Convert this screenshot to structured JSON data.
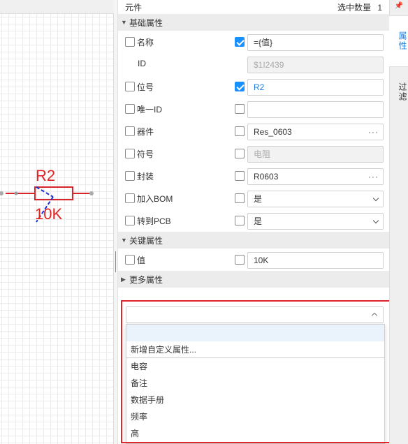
{
  "canvas": {
    "component_ref": "R2",
    "component_value": "10K",
    "colors": {
      "wire": "#d7262b",
      "label": "#e32222",
      "body": "#e32222",
      "dash": "#1a2fcf",
      "pin": "#999999"
    }
  },
  "panel": {
    "header": {
      "title": "元件",
      "count_label": "选中数量",
      "count": "1"
    },
    "sections": {
      "basic": "基础属性",
      "key": "关键属性",
      "more": "更多属性"
    },
    "rows": [
      {
        "label": "名称",
        "left_checked": false,
        "right_checked": true,
        "value": "={值}",
        "style": "normal",
        "control": "text"
      },
      {
        "label": "ID",
        "value": "$1I2439",
        "style": "disabled",
        "control": "text",
        "no_checkbox": true
      },
      {
        "label": "位号",
        "left_checked": false,
        "right_checked": true,
        "value": "R2",
        "style": "link",
        "control": "text"
      },
      {
        "label": "唯一ID",
        "left_checked": false,
        "right_checked": false,
        "value": "",
        "style": "normal",
        "control": "text"
      },
      {
        "label": "器件",
        "left_checked": false,
        "right_checked": false,
        "value": "Res_0603",
        "style": "normal",
        "control": "browse"
      },
      {
        "label": "符号",
        "left_checked": false,
        "right_checked": false,
        "value": "电阻",
        "style": "disabled",
        "control": "text"
      },
      {
        "label": "封装",
        "left_checked": false,
        "right_checked": false,
        "value": "R0603",
        "style": "normal",
        "control": "browse"
      },
      {
        "label": "加入BOM",
        "left_checked": false,
        "right_checked": false,
        "value": "是",
        "style": "normal",
        "control": "select"
      },
      {
        "label": "转到PCB",
        "left_checked": false,
        "right_checked": false,
        "value": "是",
        "style": "normal",
        "control": "select"
      }
    ],
    "key_rows": [
      {
        "label": "值",
        "left_checked": false,
        "right_checked": false,
        "value": "10K",
        "style": "normal",
        "control": "text"
      }
    ],
    "browse_glyph": "···",
    "dropdown": {
      "selected": "",
      "options": [
        "",
        "新增自定义属性...",
        "电容",
        "备注",
        "数据手册",
        "频率",
        "高"
      ]
    }
  },
  "tabs": {
    "pin_glyph": "📌",
    "items": [
      {
        "label": "属性",
        "active": true
      },
      {
        "label": "过滤",
        "active": false
      }
    ],
    "accent": "#1e7de0"
  }
}
